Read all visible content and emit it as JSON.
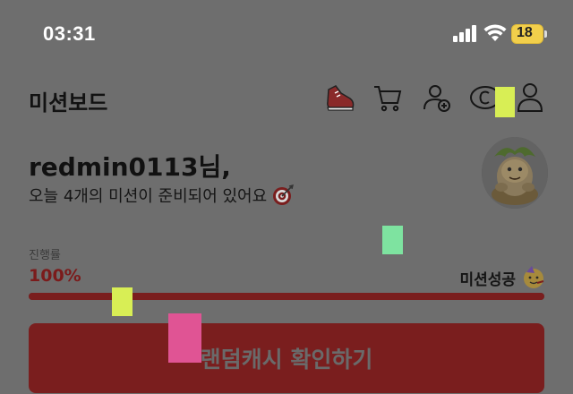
{
  "status_bar": {
    "time": "03:31",
    "battery": "18"
  },
  "header": {
    "title": "미션보드",
    "icons": [
      "shoe-icon",
      "cart-icon",
      "add-friend-icon",
      "cash-coin-icon",
      "profile-icon"
    ]
  },
  "greeting": {
    "user": "redmin0113님,",
    "sub": "오늘 4개의 미션이 준비되어 있어요"
  },
  "progress": {
    "label": "진행률",
    "value_text": "100%",
    "fraction": 1.0,
    "status": "미션성공"
  },
  "cta": {
    "label": "랜덤캐시 확인하기"
  },
  "colors": {
    "accent": "#7a1e1e",
    "overlay": "#6e6e6e"
  },
  "markers": [
    {
      "name": "marker-yellow-top",
      "color": "#d8ee55"
    },
    {
      "name": "marker-green",
      "color": "#7ee3a0"
    },
    {
      "name": "marker-yellow-bar",
      "color": "#d8ee55"
    },
    {
      "name": "marker-pink",
      "color": "#e05494"
    }
  ]
}
